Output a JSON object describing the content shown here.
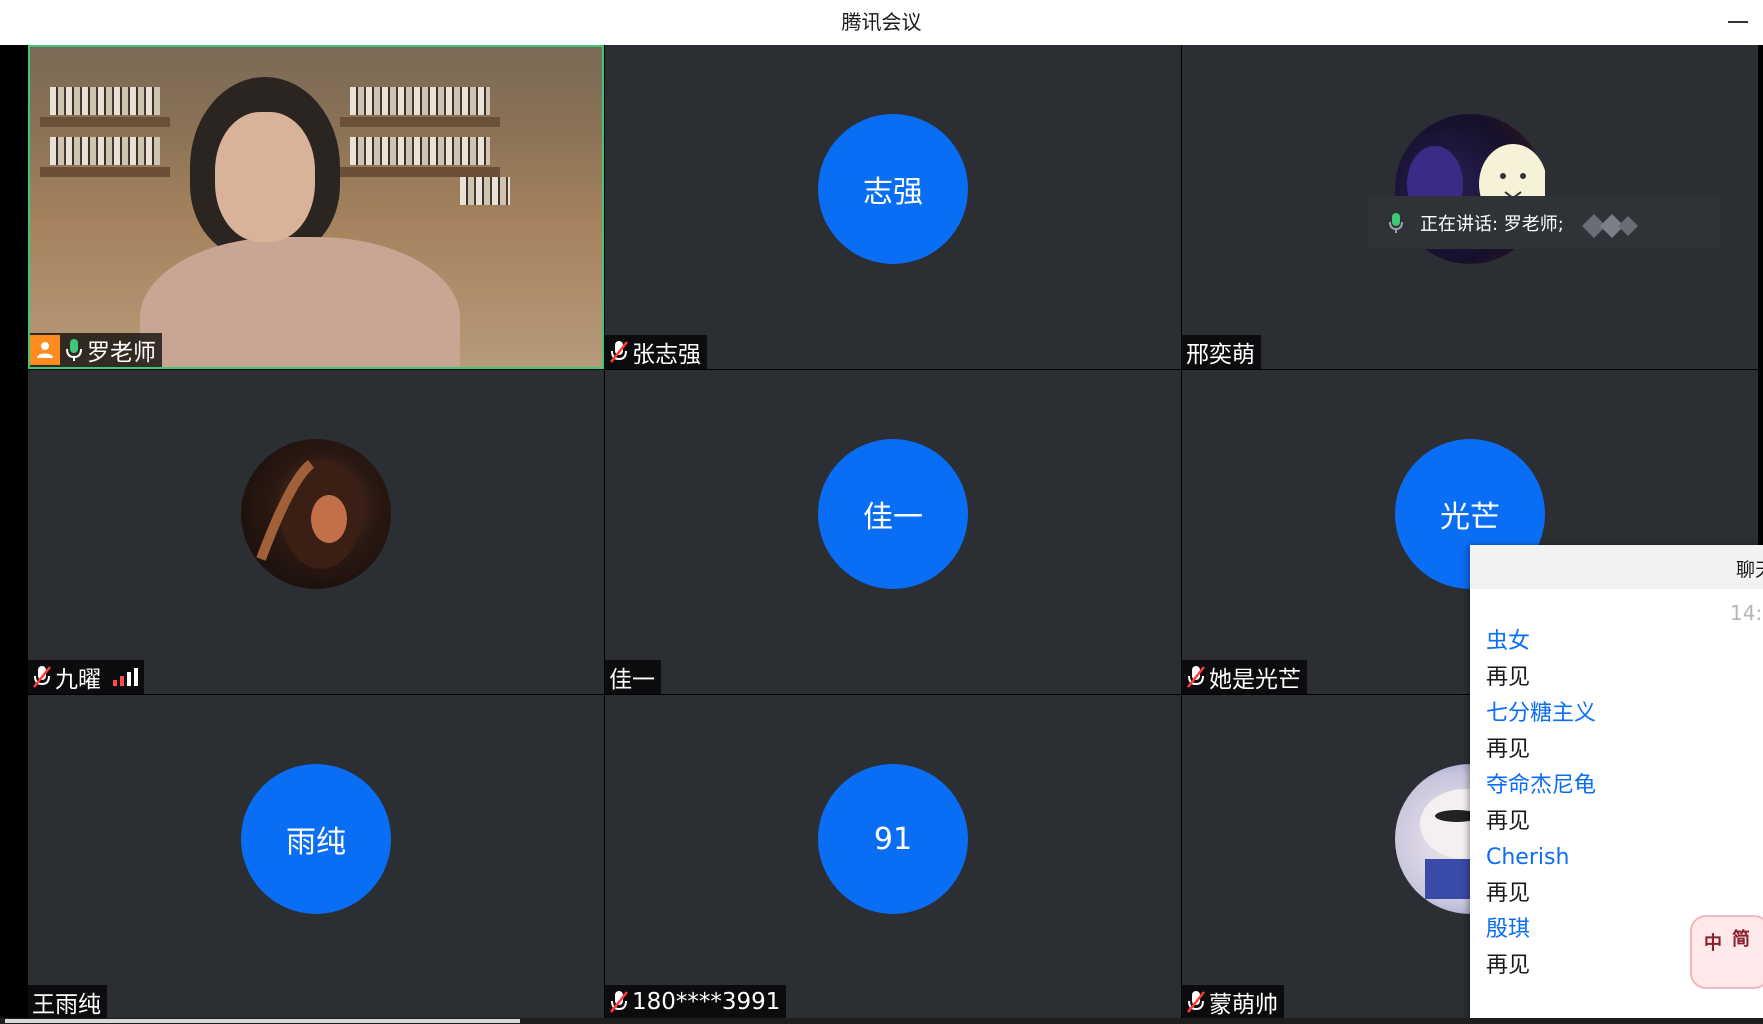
{
  "window": {
    "title": "腾讯会议"
  },
  "participants": [
    {
      "name": "罗老师",
      "avatar_text": "",
      "mic": "on",
      "host": true,
      "video": true
    },
    {
      "name": "张志强",
      "avatar_text": "志强",
      "mic": "muted"
    },
    {
      "name": "邢奕萌",
      "avatar_text": "",
      "mic": "none",
      "avatar_image": "cartoon-avatar"
    },
    {
      "name": "九曜",
      "avatar_text": "",
      "mic": "muted",
      "avatar_image": "photo-avatar",
      "signal": true
    },
    {
      "name": "佳一",
      "avatar_text": "佳一",
      "mic": "none"
    },
    {
      "name": "她是光芒",
      "avatar_text": "光芒",
      "mic": "muted"
    },
    {
      "name": "王雨纯",
      "avatar_text": "雨纯",
      "mic": "none"
    },
    {
      "name": "180****3991",
      "avatar_text": "91",
      "mic": "muted"
    },
    {
      "name": "蒙萌帅",
      "avatar_text": "",
      "mic": "muted",
      "avatar_image": "cartoon-avatar"
    }
  ],
  "speaking": {
    "text": "正在讲话: 罗老师;"
  },
  "chat": {
    "title": "聊天",
    "time": "14:",
    "messages": [
      {
        "sender": "虫女",
        "text": "再见"
      },
      {
        "sender": "七分糖主义",
        "text": "再见"
      },
      {
        "sender": "夺命杰尼龟",
        "text": "再见"
      },
      {
        "sender": "Cherish",
        "text": "再见"
      },
      {
        "sender": "殷琪",
        "text": "再见"
      }
    ]
  },
  "ime": {
    "key1": "中",
    "key2": "简"
  },
  "colors": {
    "avatar_blue": "#0a6ef5",
    "active_border": "#3cc878",
    "tile_bg": "#2b2e33",
    "host_badge": "#ff8a1f"
  }
}
